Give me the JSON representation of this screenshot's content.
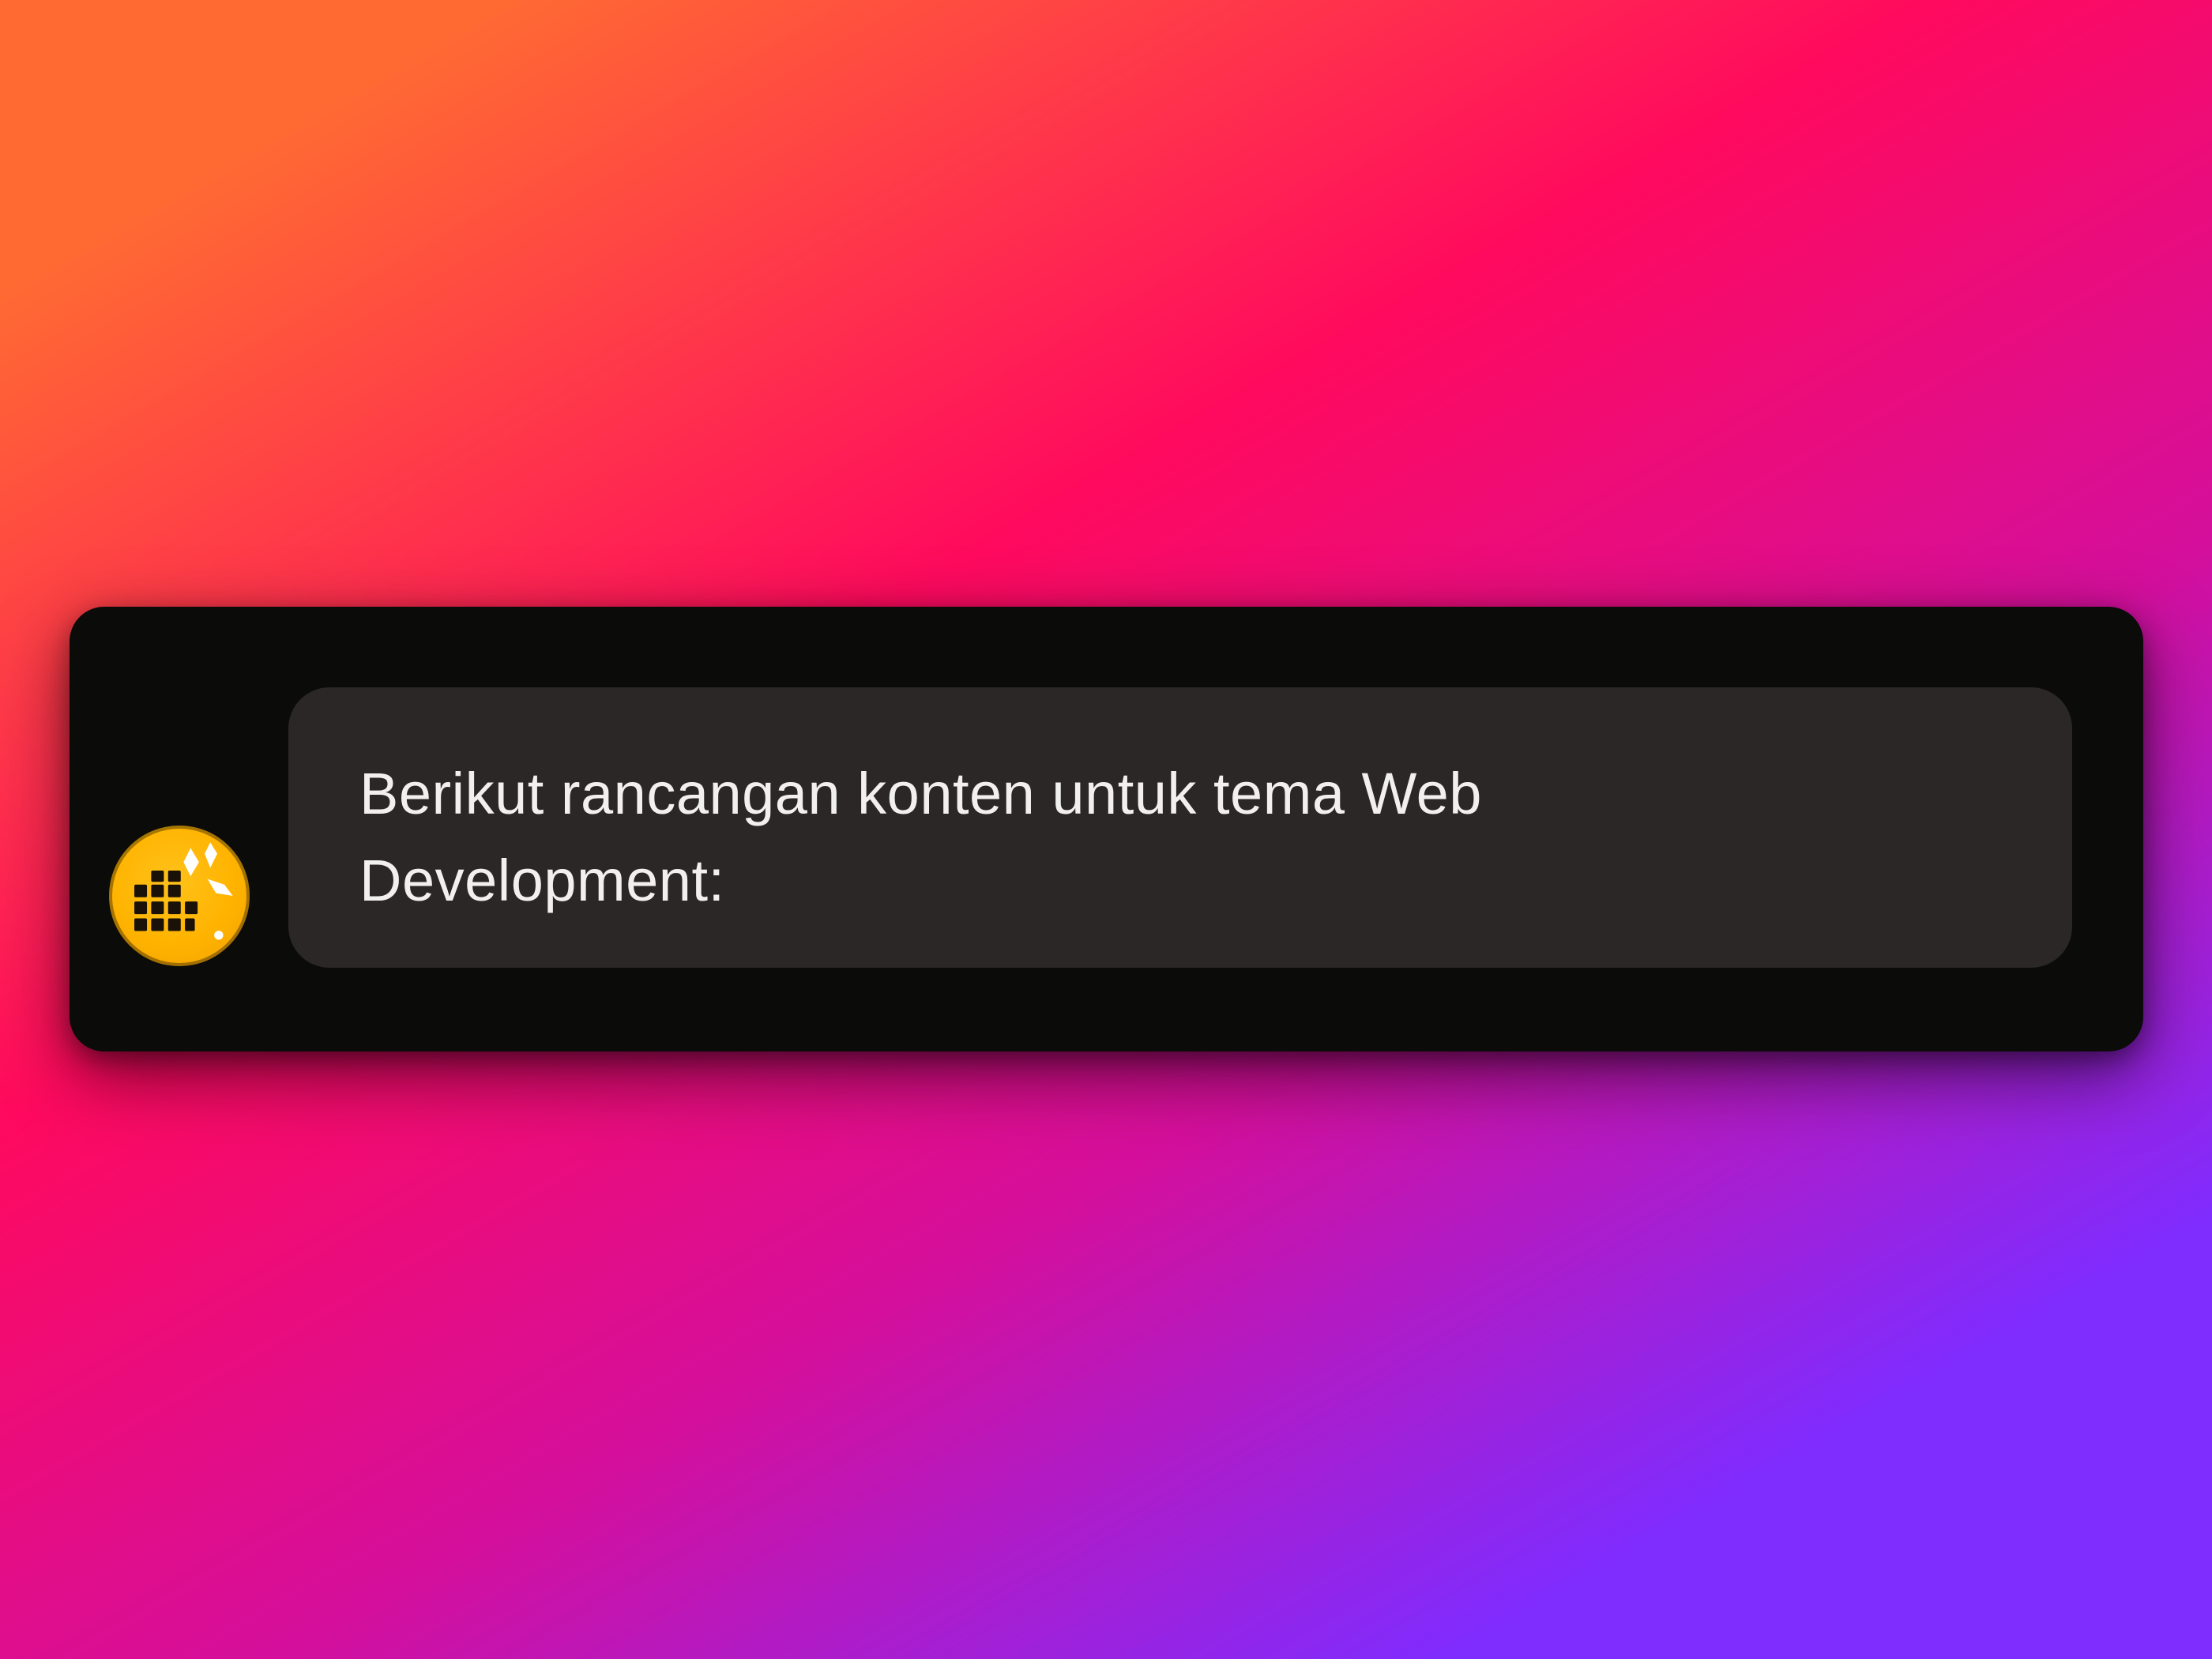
{
  "message": {
    "text": "Berikut rancangan konten untuk tema Web Development:",
    "avatar_icon": "orange-globe-sparkle-icon"
  },
  "colors": {
    "card_background": "#0b0b0a",
    "bubble_background": "#2a2726",
    "text": "#f2f0ee",
    "avatar": "#ffb300",
    "gradient_orange": "#ff6a33",
    "gradient_pink": "#ff0a5e",
    "gradient_purple": "#7f2cff"
  }
}
